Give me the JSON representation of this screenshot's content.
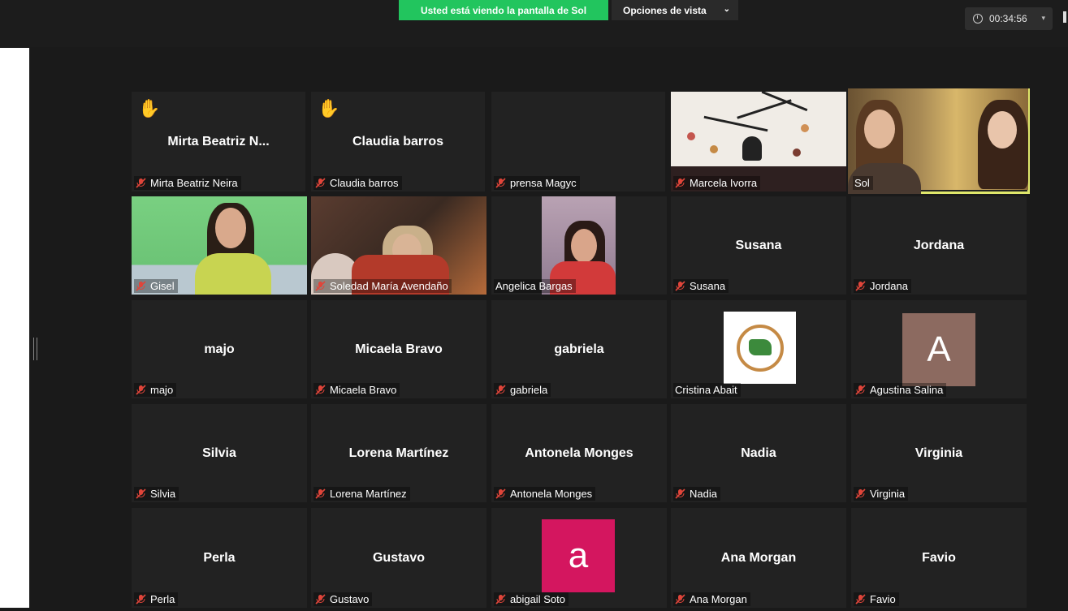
{
  "banner": {
    "text": "Usted está viendo la pantalla de Sol"
  },
  "view_options": {
    "label": "Opciones de vista",
    "icon": "chevron-down-icon"
  },
  "timer": {
    "value": "00:34:56",
    "icon": "clock-icon"
  },
  "colors": {
    "banner": "#22c55e",
    "active_speaker": "#dfe76b",
    "muted": "#e0453a",
    "tile_bg": "#222222"
  },
  "participants": [
    {
      "center": "Mirta  Beatriz  N...",
      "label": "Mirta Beatriz Neira",
      "hand": "✋"
    },
    {
      "center": "Claudia barros",
      "label": "Claudia barros",
      "hand": "✋"
    },
    {
      "label": "prensa Magyc"
    },
    {
      "label": "Marcela Ivorra"
    },
    {
      "label": "Sol"
    },
    {
      "label": "Gisel"
    },
    {
      "label": "Soledad María Avendaño"
    },
    {
      "label": "Angelica Bargas"
    },
    {
      "center": "Susana",
      "label": "Susana"
    },
    {
      "center": "Jordana",
      "label": "Jordana"
    },
    {
      "center": "majo",
      "label": "majo"
    },
    {
      "center": "Micaela Bravo",
      "label": "Micaela Bravo"
    },
    {
      "center": "gabriela",
      "label": "gabriela"
    },
    {
      "label": "Cristina Abait"
    },
    {
      "label": "Agustina Salina",
      "avatar_letter": "A"
    },
    {
      "center": "Silvia",
      "label": "Silvia"
    },
    {
      "center": "Lorena Martínez",
      "label": "Lorena Martínez"
    },
    {
      "center": "Antonela Monges",
      "label": "Antonela Monges"
    },
    {
      "center": "Nadia",
      "label": "Nadia"
    },
    {
      "center": "Virginia",
      "label": "Virginia"
    },
    {
      "center": "Perla",
      "label": "Perla"
    },
    {
      "center": "Gustavo",
      "label": "Gustavo"
    },
    {
      "label": "abigail Soto",
      "avatar_letter": "a"
    },
    {
      "center": "Ana Morgan",
      "label": "Ana Morgan"
    },
    {
      "center": "Favio",
      "label": "Favio"
    }
  ]
}
